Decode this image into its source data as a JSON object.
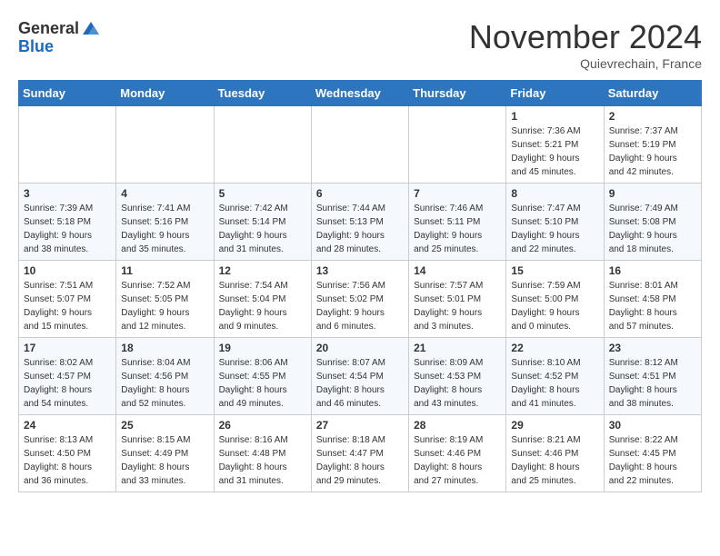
{
  "logo": {
    "general": "General",
    "blue": "Blue"
  },
  "title": "November 2024",
  "location": "Quievrechain, France",
  "weekdays": [
    "Sunday",
    "Monday",
    "Tuesday",
    "Wednesday",
    "Thursday",
    "Friday",
    "Saturday"
  ],
  "weeks": [
    [
      {
        "day": "",
        "info": ""
      },
      {
        "day": "",
        "info": ""
      },
      {
        "day": "",
        "info": ""
      },
      {
        "day": "",
        "info": ""
      },
      {
        "day": "",
        "info": ""
      },
      {
        "day": "1",
        "info": "Sunrise: 7:36 AM\nSunset: 5:21 PM\nDaylight: 9 hours\nand 45 minutes."
      },
      {
        "day": "2",
        "info": "Sunrise: 7:37 AM\nSunset: 5:19 PM\nDaylight: 9 hours\nand 42 minutes."
      }
    ],
    [
      {
        "day": "3",
        "info": "Sunrise: 7:39 AM\nSunset: 5:18 PM\nDaylight: 9 hours\nand 38 minutes."
      },
      {
        "day": "4",
        "info": "Sunrise: 7:41 AM\nSunset: 5:16 PM\nDaylight: 9 hours\nand 35 minutes."
      },
      {
        "day": "5",
        "info": "Sunrise: 7:42 AM\nSunset: 5:14 PM\nDaylight: 9 hours\nand 31 minutes."
      },
      {
        "day": "6",
        "info": "Sunrise: 7:44 AM\nSunset: 5:13 PM\nDaylight: 9 hours\nand 28 minutes."
      },
      {
        "day": "7",
        "info": "Sunrise: 7:46 AM\nSunset: 5:11 PM\nDaylight: 9 hours\nand 25 minutes."
      },
      {
        "day": "8",
        "info": "Sunrise: 7:47 AM\nSunset: 5:10 PM\nDaylight: 9 hours\nand 22 minutes."
      },
      {
        "day": "9",
        "info": "Sunrise: 7:49 AM\nSunset: 5:08 PM\nDaylight: 9 hours\nand 18 minutes."
      }
    ],
    [
      {
        "day": "10",
        "info": "Sunrise: 7:51 AM\nSunset: 5:07 PM\nDaylight: 9 hours\nand 15 minutes."
      },
      {
        "day": "11",
        "info": "Sunrise: 7:52 AM\nSunset: 5:05 PM\nDaylight: 9 hours\nand 12 minutes."
      },
      {
        "day": "12",
        "info": "Sunrise: 7:54 AM\nSunset: 5:04 PM\nDaylight: 9 hours\nand 9 minutes."
      },
      {
        "day": "13",
        "info": "Sunrise: 7:56 AM\nSunset: 5:02 PM\nDaylight: 9 hours\nand 6 minutes."
      },
      {
        "day": "14",
        "info": "Sunrise: 7:57 AM\nSunset: 5:01 PM\nDaylight: 9 hours\nand 3 minutes."
      },
      {
        "day": "15",
        "info": "Sunrise: 7:59 AM\nSunset: 5:00 PM\nDaylight: 9 hours\nand 0 minutes."
      },
      {
        "day": "16",
        "info": "Sunrise: 8:01 AM\nSunset: 4:58 PM\nDaylight: 8 hours\nand 57 minutes."
      }
    ],
    [
      {
        "day": "17",
        "info": "Sunrise: 8:02 AM\nSunset: 4:57 PM\nDaylight: 8 hours\nand 54 minutes."
      },
      {
        "day": "18",
        "info": "Sunrise: 8:04 AM\nSunset: 4:56 PM\nDaylight: 8 hours\nand 52 minutes."
      },
      {
        "day": "19",
        "info": "Sunrise: 8:06 AM\nSunset: 4:55 PM\nDaylight: 8 hours\nand 49 minutes."
      },
      {
        "day": "20",
        "info": "Sunrise: 8:07 AM\nSunset: 4:54 PM\nDaylight: 8 hours\nand 46 minutes."
      },
      {
        "day": "21",
        "info": "Sunrise: 8:09 AM\nSunset: 4:53 PM\nDaylight: 8 hours\nand 43 minutes."
      },
      {
        "day": "22",
        "info": "Sunrise: 8:10 AM\nSunset: 4:52 PM\nDaylight: 8 hours\nand 41 minutes."
      },
      {
        "day": "23",
        "info": "Sunrise: 8:12 AM\nSunset: 4:51 PM\nDaylight: 8 hours\nand 38 minutes."
      }
    ],
    [
      {
        "day": "24",
        "info": "Sunrise: 8:13 AM\nSunset: 4:50 PM\nDaylight: 8 hours\nand 36 minutes."
      },
      {
        "day": "25",
        "info": "Sunrise: 8:15 AM\nSunset: 4:49 PM\nDaylight: 8 hours\nand 33 minutes."
      },
      {
        "day": "26",
        "info": "Sunrise: 8:16 AM\nSunset: 4:48 PM\nDaylight: 8 hours\nand 31 minutes."
      },
      {
        "day": "27",
        "info": "Sunrise: 8:18 AM\nSunset: 4:47 PM\nDaylight: 8 hours\nand 29 minutes."
      },
      {
        "day": "28",
        "info": "Sunrise: 8:19 AM\nSunset: 4:46 PM\nDaylight: 8 hours\nand 27 minutes."
      },
      {
        "day": "29",
        "info": "Sunrise: 8:21 AM\nSunset: 4:46 PM\nDaylight: 8 hours\nand 25 minutes."
      },
      {
        "day": "30",
        "info": "Sunrise: 8:22 AM\nSunset: 4:45 PM\nDaylight: 8 hours\nand 22 minutes."
      }
    ]
  ]
}
